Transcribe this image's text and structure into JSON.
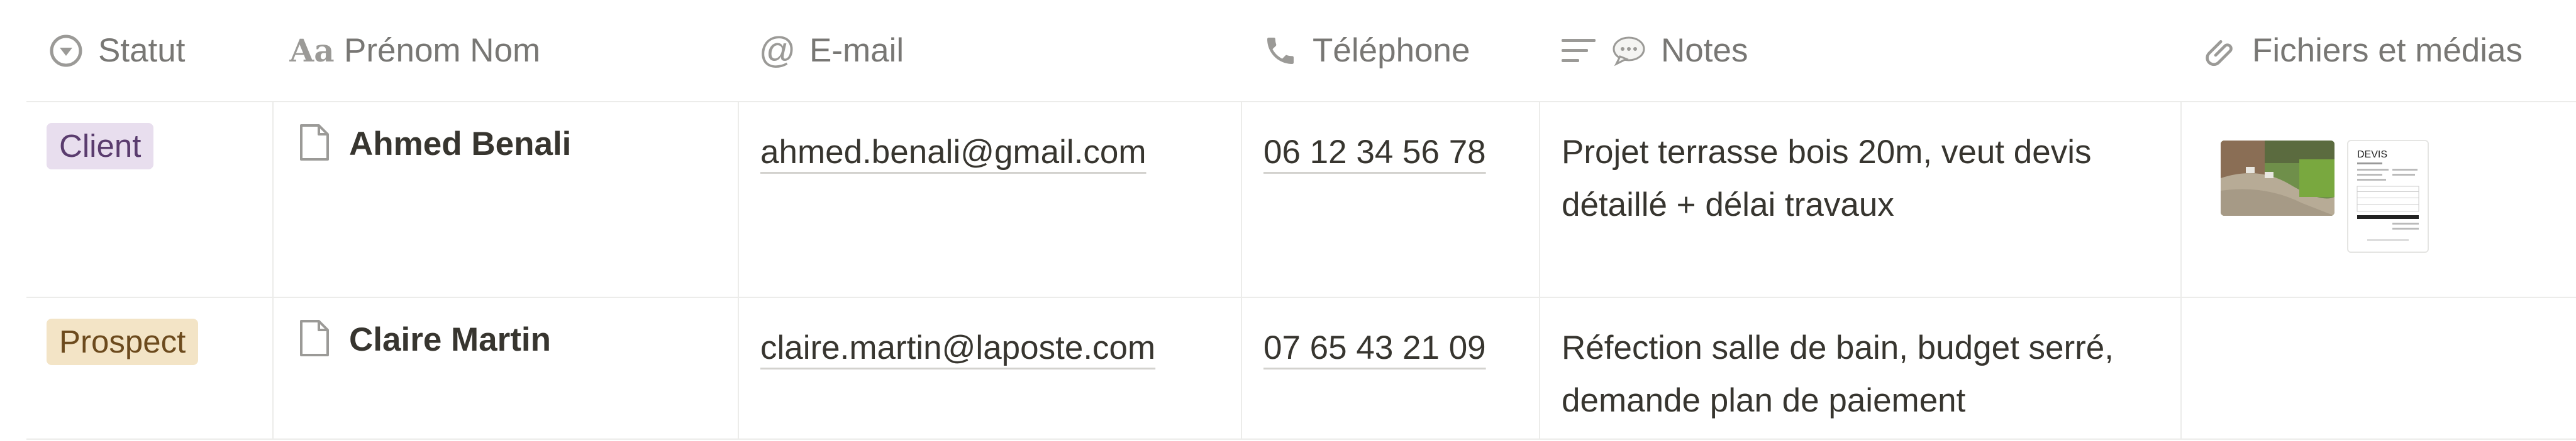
{
  "columns": {
    "statut": "Statut",
    "nom": "Prénom Nom",
    "email": "E-mail",
    "telephone": "Téléphone",
    "notes": "Notes",
    "fichiers": "Fichiers et médias"
  },
  "icons": {
    "statut": "status-circle-icon",
    "nom": "text-aa-icon",
    "email": "at-sign-icon",
    "telephone": "phone-icon",
    "notes": "lines-icon",
    "notes_extra": "speech-bubble-icon",
    "fichiers": "paperclip-icon",
    "page": "page-icon"
  },
  "colors": {
    "client_badge_bg": "#e8deee",
    "client_badge_text": "#5a3c6e",
    "prospect_badge_bg": "#f3e4c6",
    "prospect_badge_text": "#6c4a1d"
  },
  "rows": [
    {
      "statut": "Client",
      "nom": "Ahmed Benali",
      "email": "ahmed.benali@gmail.com",
      "telephone": "06 12 34 56 78",
      "notes": "Projet terrasse bois 20m, veut devis détaillé + délai travaux",
      "fichiers": [
        {
          "type": "image",
          "name": "terrasse-photo"
        },
        {
          "type": "document",
          "title": "DEVIS"
        }
      ]
    },
    {
      "statut": "Prospect",
      "nom": "Claire Martin",
      "email": "claire.martin@laposte.com",
      "telephone": "07 65 43 21 09",
      "notes": "Réfection salle de bain, budget serré, demande plan de paiement",
      "fichiers": []
    }
  ]
}
